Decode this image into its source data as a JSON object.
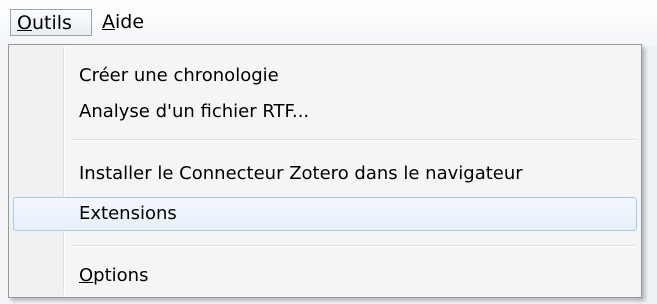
{
  "menubar": {
    "items": [
      {
        "label_pre": "",
        "accel": "O",
        "label_post": "utils"
      },
      {
        "label_pre": "",
        "accel": "A",
        "label_post": "ide"
      }
    ]
  },
  "dropdown": {
    "items": [
      {
        "label": "Créer une chronologie"
      },
      {
        "label": "Analyse d'un fichier RTF..."
      },
      {
        "label": "Installer le Connecteur Zotero dans le navigateur"
      },
      {
        "label": "Extensions"
      },
      {
        "accel": "O",
        "label_post": "ptions"
      }
    ]
  },
  "colors": {
    "hover_border": "#a8cbe8",
    "hover_fill": "#e6f0fa",
    "menu_background": "#f5f5f5"
  }
}
